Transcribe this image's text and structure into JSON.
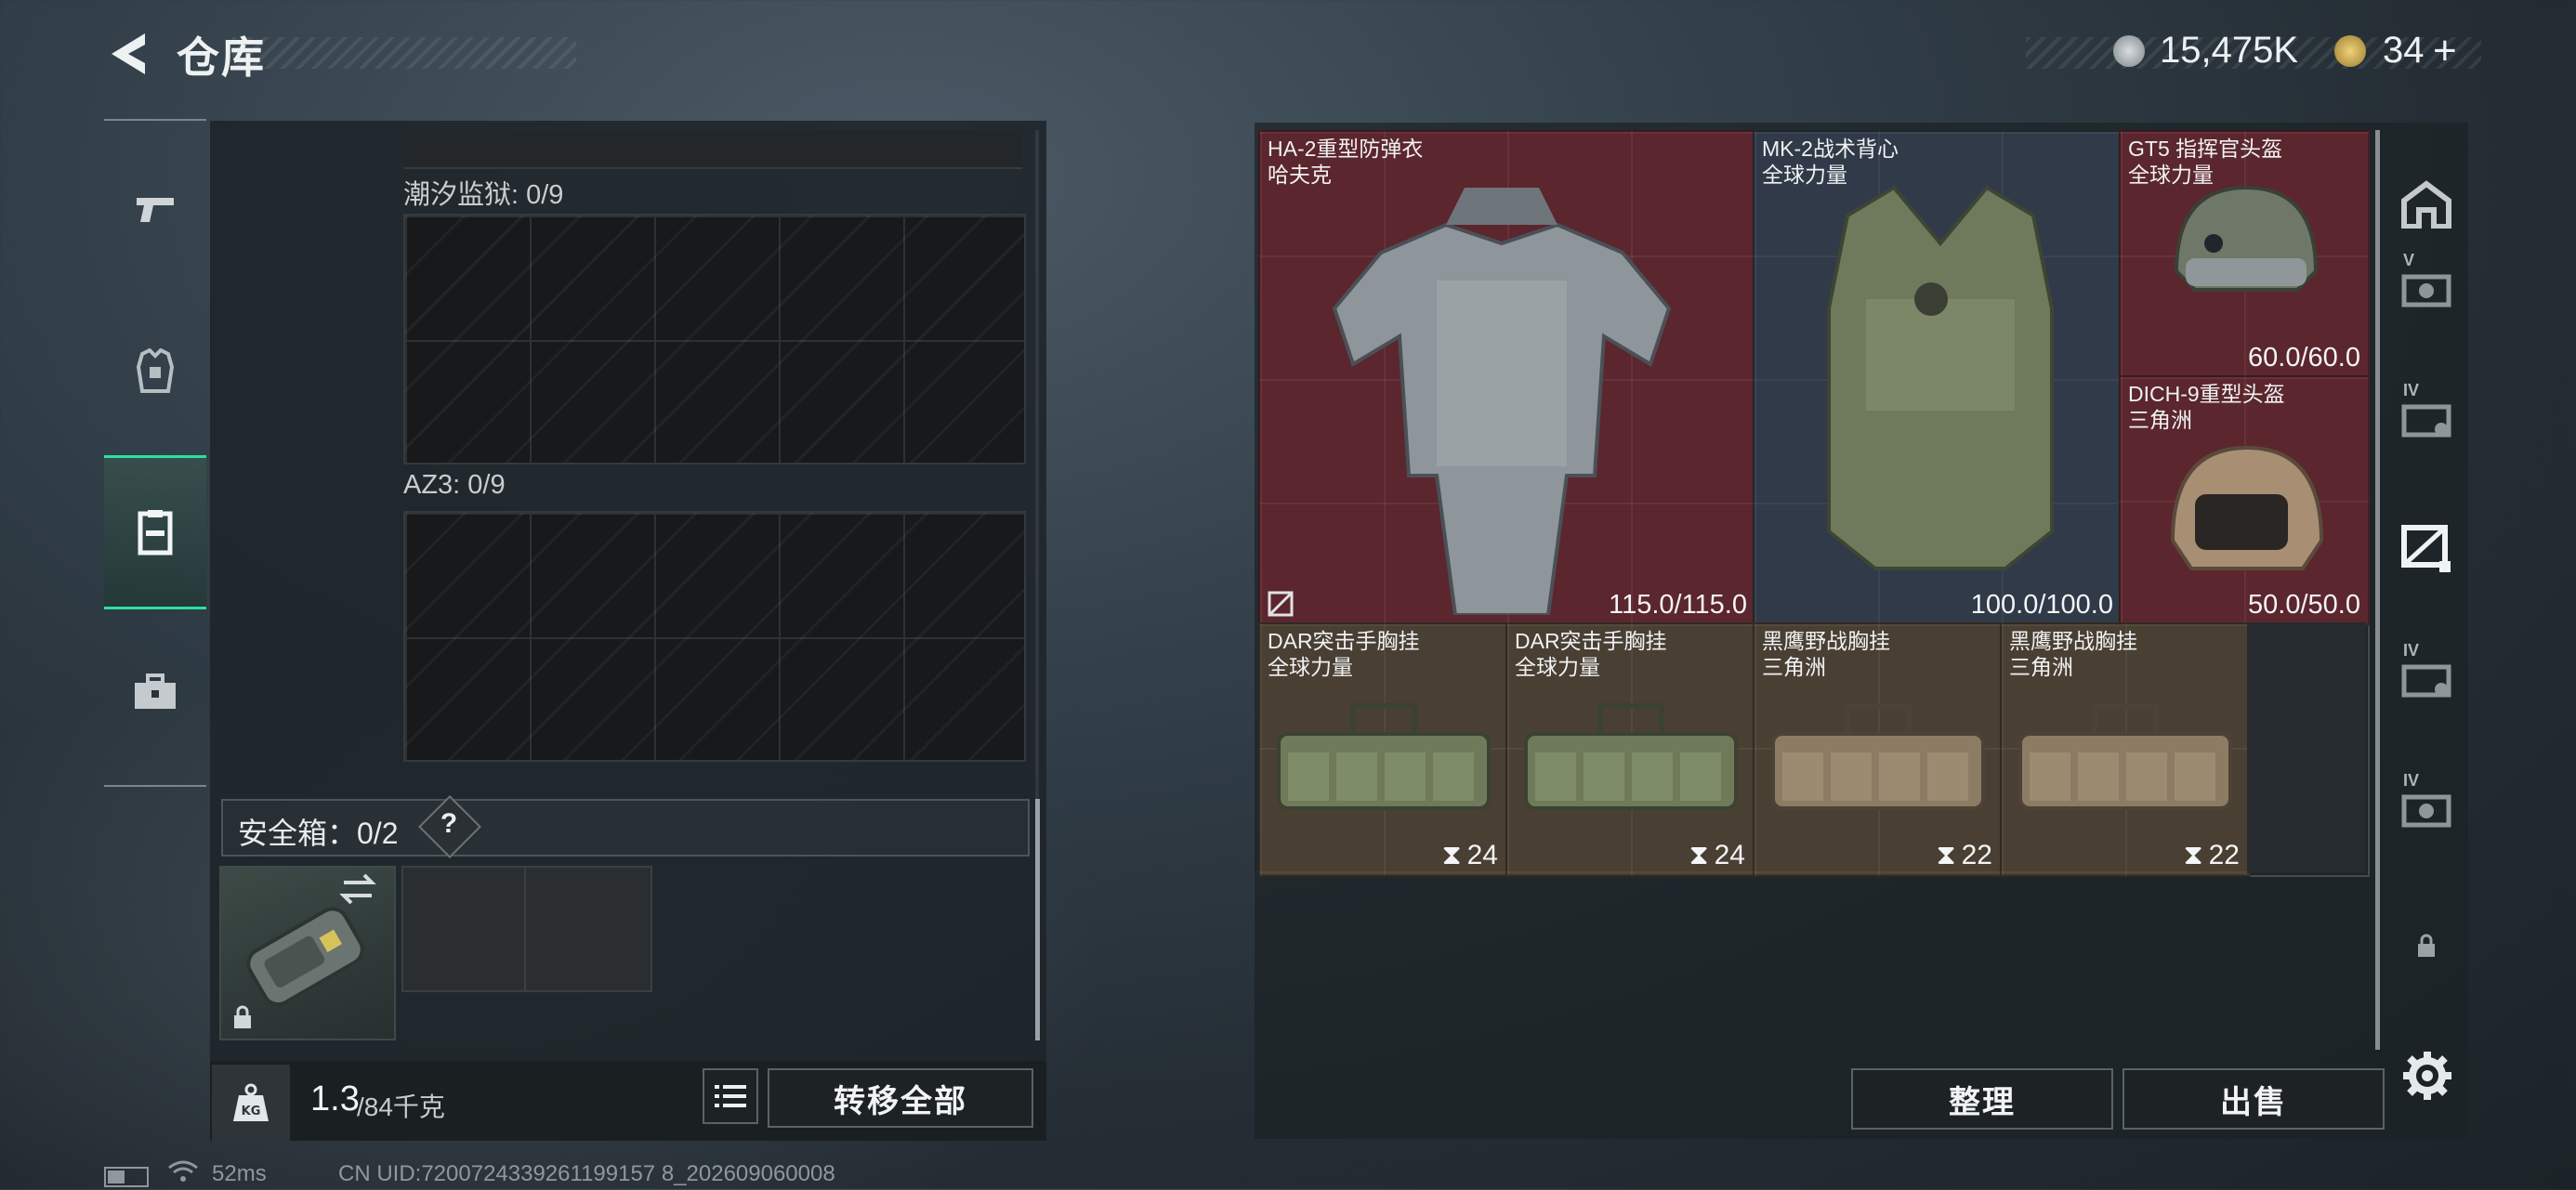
{
  "header": {
    "title": "仓库",
    "currency_amount": "15,475K",
    "tickets": "34",
    "tickets_plus": "+"
  },
  "left_nav": [
    "weapons",
    "equipment",
    "vest",
    "medkit"
  ],
  "left_panel": {
    "sections": [
      {
        "label": "潮汐监狱: 0/9"
      },
      {
        "label": "AZ3: 0/9"
      }
    ],
    "safe_box": {
      "label": "安全箱：0/2",
      "help": "?"
    },
    "weight": {
      "current": "1.3",
      "max": "/84千克"
    },
    "transfer_all": "转移全部"
  },
  "stash_items": [
    {
      "name": "HA-2重型防弹衣",
      "sub": "哈夫克",
      "value": "115.0/115.0",
      "rarity": "red"
    },
    {
      "name": "MK-2战术背心",
      "sub": "全球力量",
      "value": "100.0/100.0",
      "rarity": "blue"
    },
    {
      "name": "GT5 指挥官头盔",
      "sub": "全球力量",
      "value": "60.0/60.0",
      "rarity": "red"
    },
    {
      "name": "DICH-9重型头盔",
      "sub": "三角洲",
      "value": "50.0/50.0",
      "rarity": "red"
    },
    {
      "name": "DAR突击手胸挂",
      "sub": "全球力量",
      "capacity": "24",
      "rarity": "brown"
    },
    {
      "name": "DAR突击手胸挂",
      "sub": "全球力量",
      "capacity": "24",
      "rarity": "brown"
    },
    {
      "name": "黑鹰野战胸挂",
      "sub": "三角洲",
      "capacity": "22",
      "rarity": "brown"
    },
    {
      "name": "黑鹰野战胸挂",
      "sub": "三角洲",
      "capacity": "22",
      "rarity": "brown"
    }
  ],
  "right_tabs": [
    {
      "tag": "",
      "icon": "house-icon"
    },
    {
      "tag": "V",
      "icon": "stash-v-icon"
    },
    {
      "tag": "IV",
      "icon": "stash-iv-icon"
    },
    {
      "tag": "",
      "icon": "stash-active-icon"
    },
    {
      "tag": "IV",
      "icon": "stash-iv-2-icon"
    },
    {
      "tag": "IV",
      "icon": "stash-iv-3-icon"
    },
    {
      "tag": "",
      "icon": "lock-icon"
    }
  ],
  "actions": {
    "organize": "整理",
    "sell": "出售"
  },
  "status_bar": {
    "ping": "52ms",
    "uid": "CN UID:7200724339261199157 8_202609060008"
  },
  "colors": {
    "accent": "#2ee0a0",
    "red_rarity": "#5b262d",
    "blue_rarity": "#303a48",
    "brown_rarity": "#4a3f33"
  }
}
